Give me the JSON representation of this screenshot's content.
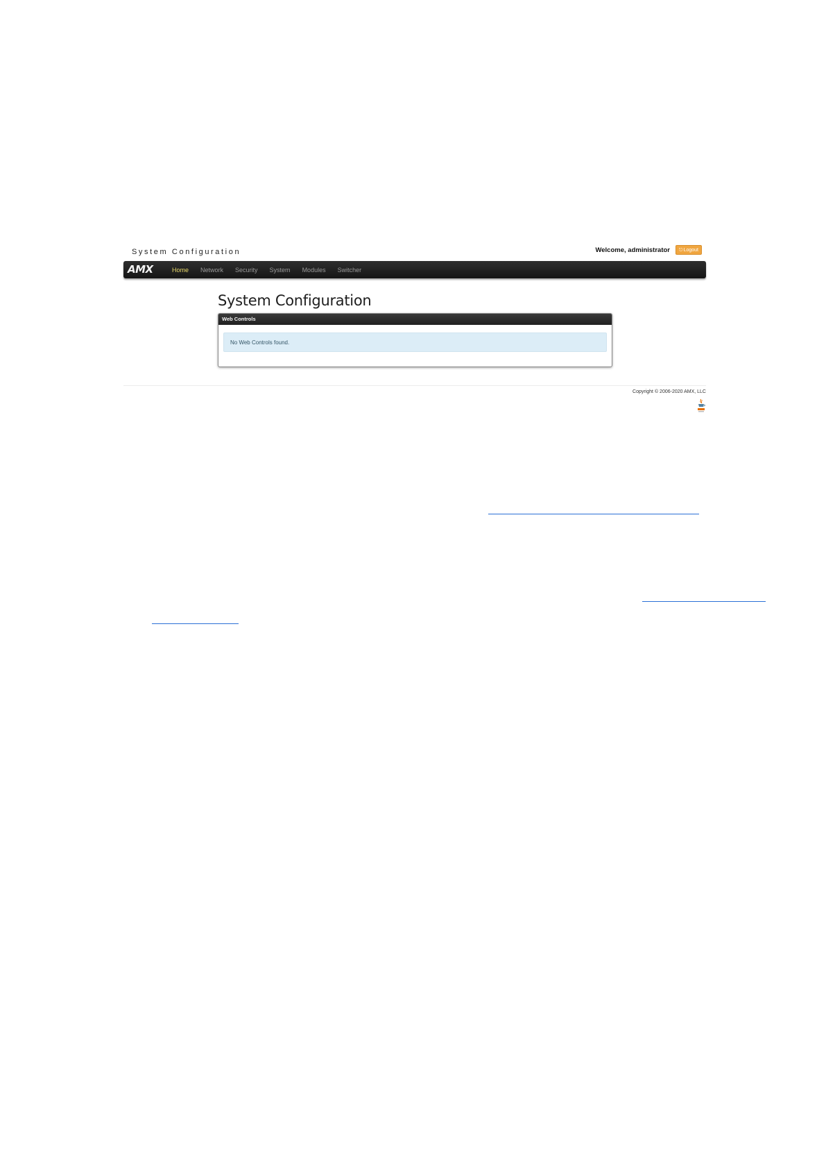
{
  "app": {
    "title": "System Configuration",
    "welcome_text": "Welcome, administrator",
    "logout_label": "Logout",
    "brand": "AMX"
  },
  "nav": {
    "items": [
      {
        "label": "Home",
        "active": true
      },
      {
        "label": "Network",
        "active": false
      },
      {
        "label": "Security",
        "active": false
      },
      {
        "label": "System",
        "active": false
      },
      {
        "label": "Modules",
        "active": false
      },
      {
        "label": "Switcher",
        "active": false
      }
    ]
  },
  "main": {
    "heading": "System Configuration",
    "panel": {
      "title": "Web Controls",
      "message": "No Web Controls found."
    }
  },
  "footer": {
    "copyright": "Copyright © 2006-2020 AMX, LLC"
  },
  "colors": {
    "accent_active_nav": "#e8d96a",
    "logout_button": "#f0a640",
    "navbar": "#1e1e1e",
    "info_alert": "#dcedf7",
    "link_underline": "#2a6fd6"
  }
}
